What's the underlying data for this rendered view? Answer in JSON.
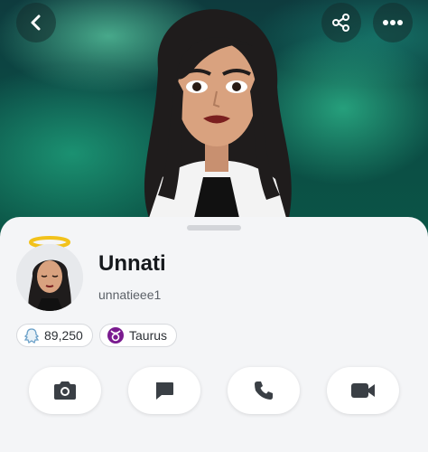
{
  "header": {
    "back_icon": "chevron-left-icon",
    "share_icon": "share-icon",
    "more_icon": "more-horizontal-icon"
  },
  "profile": {
    "display_name": "Unnati",
    "username": "unnatieee1",
    "score": "89,250",
    "zodiac": "Taurus"
  },
  "actions": [
    {
      "icon": "camera-icon"
    },
    {
      "icon": "chat-icon"
    },
    {
      "icon": "phone-icon"
    },
    {
      "icon": "video-icon"
    }
  ],
  "colors": {
    "zodiac_accent": "#7a1b8f",
    "sheet_background": "#f4f5f7",
    "hero_green": "#1fd39a"
  }
}
